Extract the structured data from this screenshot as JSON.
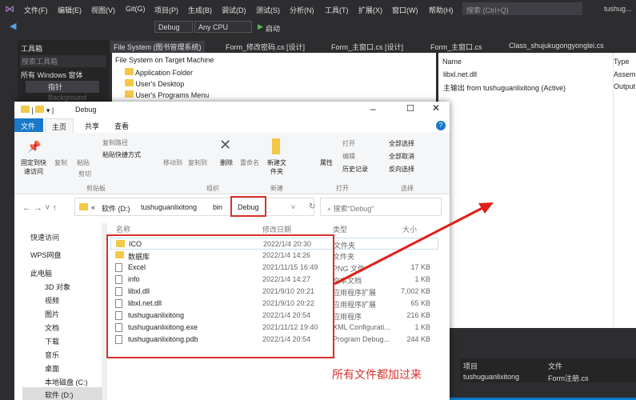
{
  "vs": {
    "menu": [
      "文件(F)",
      "编辑(E)",
      "视图(V)",
      "Git(G)",
      "项目(P)",
      "生成(B)",
      "调试(D)",
      "测试(S)",
      "分析(N)",
      "工具(T)",
      "扩展(X)",
      "窗口(W)",
      "帮助(H)"
    ],
    "search_placeholder": "搜索 (Ctrl+Q)",
    "solution": "tushug...",
    "config": "Debug",
    "platform": "Any CPU",
    "start": "启动",
    "tabs": [
      "File System (图书管理系统)",
      "Form_修改密码.cs [设计]",
      "Form_主窗口.cs [设计]",
      "Form_主窗口.cs",
      "Class_shujukugongyonglei.cs"
    ],
    "toolbox": {
      "title": "工具箱",
      "search": "搜索工具箱",
      "group": "所有 Windows 窗体",
      "items": [
        "指针",
        "Background"
      ]
    },
    "tree": [
      "File System on Target Machine",
      "Application Folder",
      "User's Desktop",
      "User's Programs Menu"
    ],
    "right_panel": {
      "col_name": "Name",
      "col_type": "Type",
      "rows": [
        {
          "name": "libxl.net.dll",
          "type": "Assem"
        },
        {
          "name": "主输出 from tushuguanlixitong (Active)",
          "type": "Output"
        }
      ]
    },
    "bottom": {
      "col_project": "项目",
      "col_file": "文件",
      "project": "tushuguanlixitong",
      "file": "Form注册.cs"
    }
  },
  "explorer": {
    "title": "Debug",
    "ribbon_tabs": [
      "文件",
      "主页",
      "共享",
      "查看"
    ],
    "ribbon": {
      "pin": "固定到快速访问",
      "copy": "复制",
      "paste": "粘贴",
      "copy_path": "复制路径",
      "paste_shortcut": "粘贴快捷方式",
      "cut": "剪切",
      "clipboard": "剪贴板",
      "move_to": "移动到",
      "copy_to": "复制到",
      "delete": "删除",
      "rename": "重命名",
      "organize": "组织",
      "new_folder": "新建文件夹",
      "new": "新建",
      "properties": "属性",
      "open": "打开",
      "edit": "编辑",
      "history": "历史记录",
      "open_group": "打开",
      "select_all": "全部选择",
      "select_none": "全部取消",
      "invert": "反向选择",
      "select_group": "选择"
    },
    "path": [
      "«",
      "软件 (D:)",
      "tushuguanlixitong",
      "bin",
      "Debug"
    ],
    "search_placeholder": "搜索\"Debug\"",
    "columns": [
      "名称",
      "修改日期",
      "类型",
      "大小"
    ],
    "files": [
      {
        "name": "ICO",
        "date": "2022/1/4 20:30",
        "type": "文件夹",
        "size": "",
        "icon": "folder"
      },
      {
        "name": "数据库",
        "date": "2022/1/4 14:26",
        "type": "文件夹",
        "size": "",
        "icon": "folder"
      },
      {
        "name": "Excel",
        "date": "2021/11/15 16:49",
        "type": "PNG 文件",
        "size": "17 KB",
        "icon": "file"
      },
      {
        "name": "info",
        "date": "2022/1/4 14:27",
        "type": "文本文档",
        "size": "1 KB",
        "icon": "file"
      },
      {
        "name": "libxl.dll",
        "date": "2021/9/10 20:21",
        "type": "应用程序扩展",
        "size": "7,002 KB",
        "icon": "file"
      },
      {
        "name": "libxl.net.dll",
        "date": "2021/9/10 20:22",
        "type": "应用程序扩展",
        "size": "65 KB",
        "icon": "file"
      },
      {
        "name": "tushuguanlixitong",
        "date": "2022/1/4 20:54",
        "type": "应用程序",
        "size": "216 KB",
        "icon": "app"
      },
      {
        "name": "tushuguanlixitong.exe",
        "date": "2021/11/12 19:40",
        "type": "XML Configurati...",
        "size": "1 KB",
        "icon": "file"
      },
      {
        "name": "tushuguanlixitong.pdb",
        "date": "2022/1/4 20:54",
        "type": "Program Debug...",
        "size": "244 KB",
        "icon": "file"
      }
    ],
    "nav": [
      "快速访问",
      "WPS网盘",
      "此电脑",
      "3D 对象",
      "视频",
      "图片",
      "文档",
      "下载",
      "音乐",
      "桌面",
      "本地磁盘 (C:)",
      "软件 (D:)"
    ]
  },
  "annotation": "所有文件都加过来",
  "colors": {
    "accent": "#1979ca",
    "red": "#d9302b"
  }
}
